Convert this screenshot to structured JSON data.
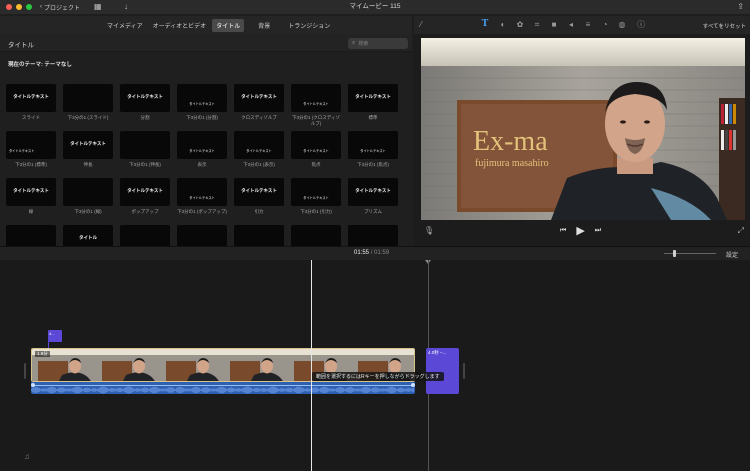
{
  "window": {
    "back_label": "プロジェクト",
    "title": "マイムービー 115"
  },
  "media_tabs": [
    {
      "label": "マイメディア"
    },
    {
      "label": "オーディオとビデオ"
    },
    {
      "label": "タイトル"
    },
    {
      "label": "背景"
    },
    {
      "label": "トランジション"
    }
  ],
  "inspector": {
    "reset_label": "すべてをリセット"
  },
  "browser": {
    "header": "タイトル",
    "search_placeholder": "検索",
    "theme_label": "現在のテーマ: テーマなし",
    "rows": [
      [
        {
          "caption": "スライド",
          "text": "タイトルテキスト"
        },
        {
          "caption": "下3分の1 (スライド)",
          "text": ""
        },
        {
          "caption": "分割",
          "text": "タイトルテキスト"
        },
        {
          "caption": "下3分の1 (分割)",
          "text": "タイトルテキスト"
        },
        {
          "caption": "クロスディゾルブ",
          "text": "タイトルテキスト"
        },
        {
          "caption": "下3分の1 (クロスディゾルブ)",
          "text": "タイトルテキスト"
        },
        {
          "caption": "標準",
          "text": "タイトルテキスト"
        }
      ],
      [
        {
          "caption": "下3分の1 (標準)",
          "text": "タイトルテキスト"
        },
        {
          "caption": "伸長",
          "text": "タイトルテキスト"
        },
        {
          "caption": "下3分の1 (伸長)",
          "text": ""
        },
        {
          "caption": "表示",
          "text": "タイトルテキスト"
        },
        {
          "caption": "下3分の1 (表示)",
          "text": "タイトルテキスト"
        },
        {
          "caption": "焦点",
          "text": "タイトルテキスト"
        },
        {
          "caption": "下3分の1 (焦点)",
          "text": "タイトルテキスト"
        }
      ],
      [
        {
          "caption": "線",
          "text": "タイトルテキスト"
        },
        {
          "caption": "下3分の1 (線)",
          "text": ""
        },
        {
          "caption": "ポップアップ",
          "text": "タイトルテキスト"
        },
        {
          "caption": "下3分の1 (ポップアップ)",
          "text": "タイトルテキスト"
        },
        {
          "caption": "引力",
          "text": "タイトルテキスト"
        },
        {
          "caption": "下3分の1 (引力)",
          "text": "タイトルテキスト"
        },
        {
          "caption": "プリズム",
          "text": "タイトルテキスト"
        }
      ],
      [
        {
          "caption": "",
          "text": ""
        },
        {
          "caption": "",
          "text": "タイトル"
        },
        {
          "caption": "",
          "text": ""
        },
        {
          "caption": "",
          "text": ""
        },
        {
          "caption": "",
          "text": ""
        },
        {
          "caption": "",
          "text": ""
        },
        {
          "caption": "",
          "text": ""
        }
      ]
    ]
  },
  "viewer": {
    "sign_line1": "Ex-ma",
    "sign_line2": "fujimura masahiro"
  },
  "timeline": {
    "current_time": "01:55",
    "separator": "/",
    "total_time": "01:59",
    "settings_label": "設定",
    "clip_duration": "1.9分",
    "title_marker_label": "4...",
    "title_clip_label": "4.0秒 –...",
    "tooltip": "範囲を選択するにはRキーを押しながらドラッグします"
  }
}
